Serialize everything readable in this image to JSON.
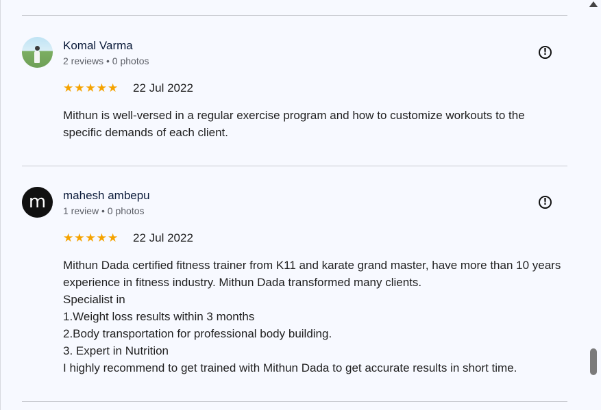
{
  "reviews": [
    {
      "name": "Komal Varma",
      "meta": "2 reviews • 0 photos",
      "stars": "★★★★★",
      "rating": 5,
      "date": "22 Jul 2022",
      "text": "Mithun is well-versed in a regular exercise program and how to customize workouts to the specific demands of each client."
    },
    {
      "name": "mahesh ambepu",
      "avatar_letter": "m",
      "meta": "1 review • 0 photos",
      "stars": "★★★★★",
      "rating": 5,
      "date": "22 Jul 2022",
      "text": "Mithun Dada certified fitness trainer from K11 and karate grand master, have more than 10 years experience in fitness industry. Mithun Dada transformed many clients.\nSpecialist in\n1.Weight loss results within 3 months\n2.Body transportation for professional body building.\n3. Expert in Nutrition\nI highly recommend to get trained with Mithun Dada to get accurate results in short time."
    }
  ],
  "icons": {
    "flag": "report-flag-icon",
    "flag_glyph": "!",
    "scroll_up": "scroll-up-arrow-icon"
  },
  "colors": {
    "star": "#f5a300",
    "background": "#f7f9ff",
    "divider": "#c7c9cf"
  }
}
